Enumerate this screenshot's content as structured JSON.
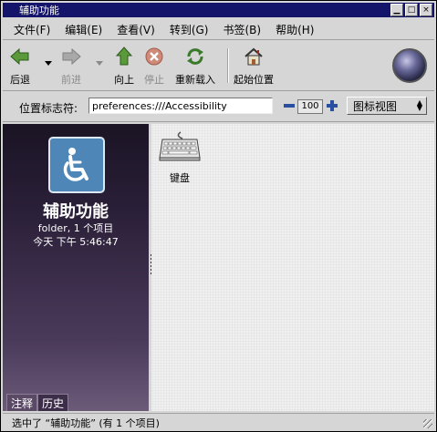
{
  "window": {
    "title": "辅助功能"
  },
  "menu": [
    "文件(F)",
    "编辑(E)",
    "查看(V)",
    "转到(G)",
    "书签(B)",
    "帮助(H)"
  ],
  "toolbar": {
    "back": "后退",
    "forward": "前进",
    "up": "向上",
    "stop": "停止",
    "reload": "重新载入",
    "home": "起始位置"
  },
  "location": {
    "label": "位置标志符:",
    "value": "preferences:///Accessibility",
    "zoom": "100",
    "view": "图标视图"
  },
  "sidebar": {
    "name": "辅助功能",
    "info": "folder, 1 个项目",
    "date": "今天 下午 5:46:47",
    "tabs": [
      "注释",
      "历史"
    ]
  },
  "items": [
    {
      "label": "键盘",
      "icon": "keyboard-icon"
    }
  ],
  "status": "选中了 “辅助功能” (有 1 个项目)",
  "colors": {
    "titlebar": "#14146b",
    "accent": "#2b4fa0"
  }
}
